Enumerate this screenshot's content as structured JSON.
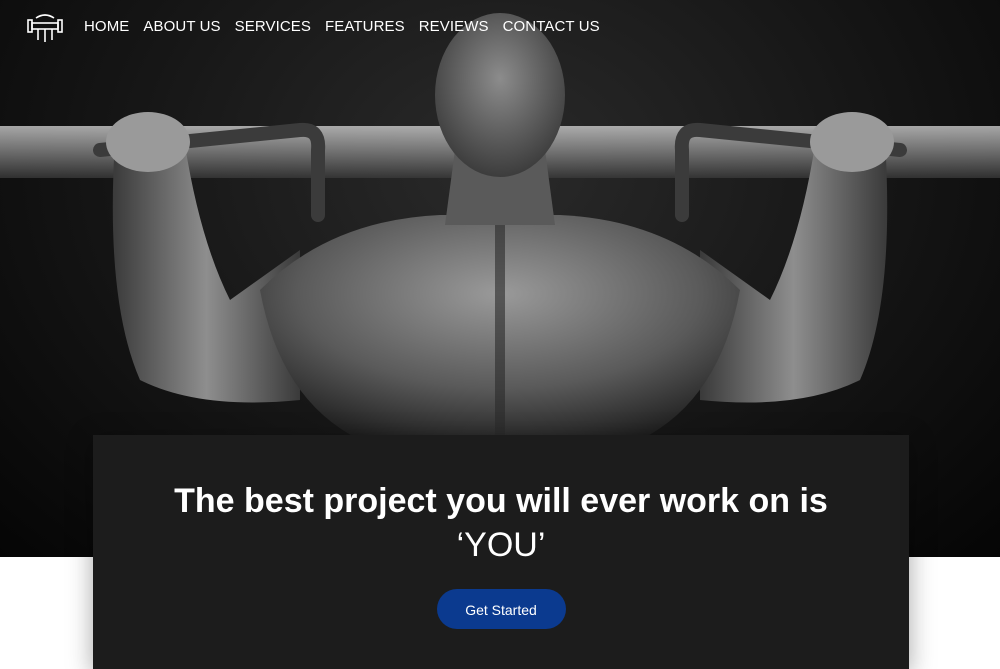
{
  "nav": {
    "logo": "dumbbell-fist-logo",
    "links": [
      "HOME",
      "ABOUT US",
      "SERVICES",
      "FEATURES",
      "REVIEWS",
      "CONTACT US"
    ]
  },
  "hero": {
    "image": "muscular man doing pull-ups, black and white",
    "headline_line1": "The best project you will ever work on is",
    "headline_line2": "‘YOU’",
    "cta_label": "Get Started"
  },
  "colors": {
    "cta_background": "#0b3a8f",
    "card_background": "#1c1c1c",
    "hero_background": "#111111"
  }
}
